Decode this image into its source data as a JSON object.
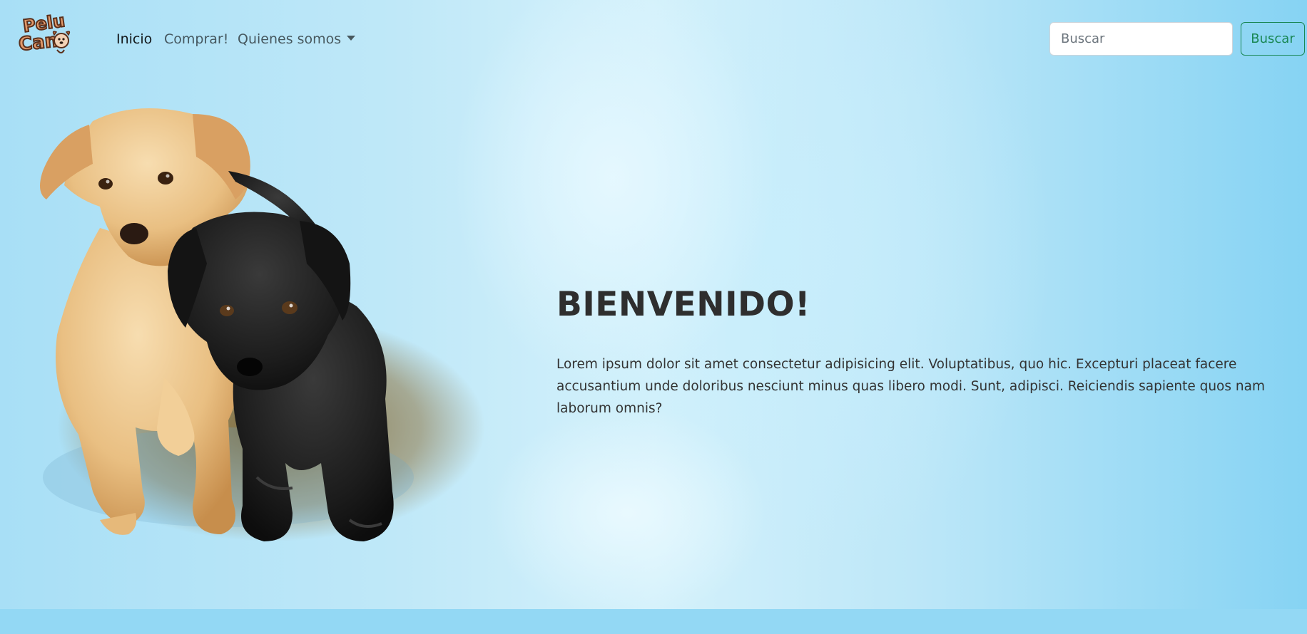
{
  "brand": {
    "logo_alt": "PeluCan",
    "logo_line1": "Pelu",
    "logo_line2": "Can"
  },
  "nav": {
    "items": [
      {
        "label": "Inicio",
        "active": true
      },
      {
        "label": "Comprar!",
        "active": false
      },
      {
        "label": "Quienes somos",
        "active": false,
        "dropdown": true
      }
    ]
  },
  "search": {
    "placeholder": "Buscar",
    "value": "",
    "button_label": "Buscar"
  },
  "hero": {
    "title": "BIENVENIDO!",
    "text": "Lorem ipsum dolor sit amet consectetur adipisicing elit. Voluptatibus, quo hic. Excepturi placeat facere accusantium unde doloribus nesciunt minus quas libero modi. Sunt, adipisci. Reiciendis sapiente quos nam laborum omnis?"
  },
  "colors": {
    "accent": "#198754",
    "background": "#8fd8f5",
    "title": "#2e2e2e"
  }
}
